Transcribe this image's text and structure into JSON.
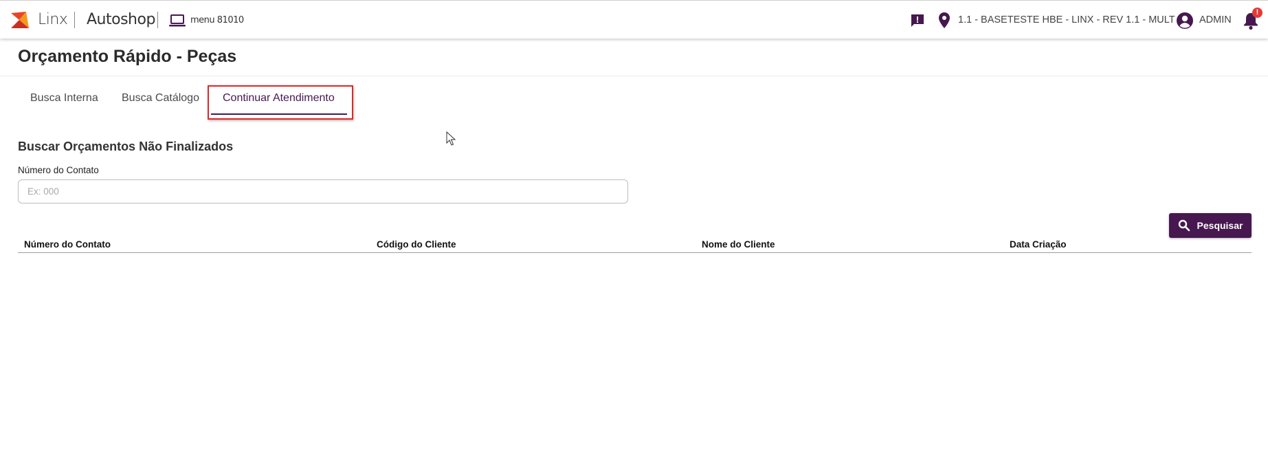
{
  "header": {
    "brand": "Linx",
    "product": "Autoshop",
    "menu_code": "menu 81010",
    "location": "1.1 - BASETESTE HBE - LINX - REV 1.1 - MULT",
    "user": "ADMIN",
    "notification_badge": "!"
  },
  "page": {
    "title": "Orçamento Rápido - Peças"
  },
  "tabs": [
    {
      "label": "Busca Interna",
      "active": false
    },
    {
      "label": "Busca Catálogo",
      "active": false
    },
    {
      "label": "Continuar Atendimento",
      "active": true
    }
  ],
  "search": {
    "section_title": "Buscar Orçamentos Não Finalizados",
    "contact_label": "Número do Contato",
    "contact_placeholder": "Ex: 000",
    "contact_value": "",
    "button_label": "Pesquisar"
  },
  "table": {
    "columns": [
      "Número do Contato",
      "Código do Cliente",
      "Nome do Cliente",
      "Data Criação"
    ],
    "rows": []
  },
  "colors": {
    "primary": "#46184f",
    "badge": "#e53935",
    "highlight": "#e02626"
  },
  "icons": [
    "linx-logo",
    "laptop-icon",
    "chat-alert-icon",
    "location-pin-icon",
    "account-circle-icon",
    "bell-icon",
    "search-icon",
    "mouse-cursor"
  ]
}
